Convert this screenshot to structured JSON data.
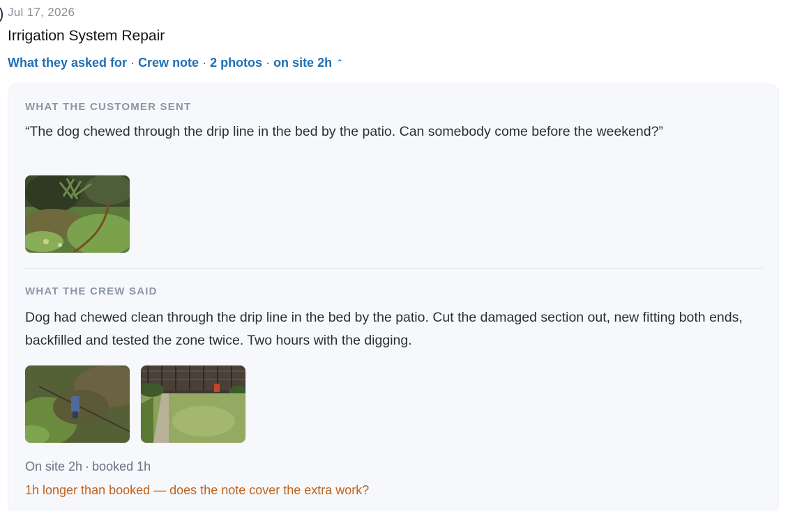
{
  "entry": {
    "date": "Jul 17, 2026",
    "title": "Irrigation System Repair",
    "summary": {
      "asked": "What they asked for",
      "crew_note": "Crew note",
      "photos": "2 photos",
      "on_site": "on site 2h",
      "chevron_icon": "chevron-up-icon"
    }
  },
  "customer": {
    "label": "WHAT THE CUSTOMER SENT",
    "message": "“The dog chewed through the drip line in the bed by the patio. Can somebody come before the weekend?”",
    "photos": [
      {
        "name": "customer-photo-1",
        "kind": "garden bed with chewed drip line"
      }
    ]
  },
  "crew": {
    "label": "WHAT THE CREW SAID",
    "note": "Dog had chewed clean through the drip line in the bed by the patio. Cut the damaged section out, new fitting both ends, backfilled and tested the zone twice. Two hours with the digging.",
    "photos": [
      {
        "name": "crew-photo-1",
        "kind": "lawn with repaired fitting"
      },
      {
        "name": "crew-photo-2",
        "kind": "backyard lawn and fence"
      }
    ]
  },
  "stats": {
    "on_site": "On site 2h",
    "booked": "booked 1h",
    "separator": "·"
  },
  "warning": "1h longer than booked — does the note cover the extra work?",
  "colors": {
    "accent": "#1f6fb5",
    "warning": "#c0621a",
    "panel": "#f6f8fb"
  }
}
